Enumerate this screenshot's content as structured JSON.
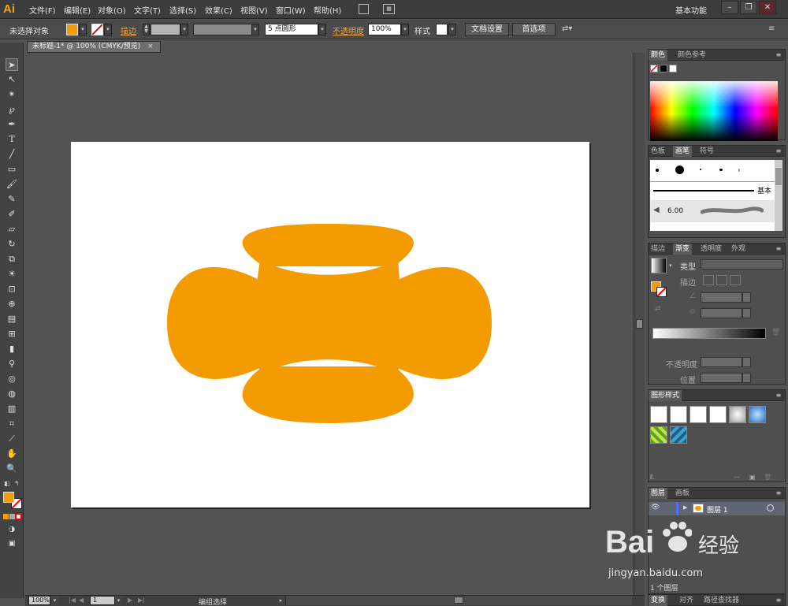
{
  "app": {
    "logo": "Ai",
    "workspace": "基本功能"
  },
  "menu": [
    "文件(F)",
    "编辑(E)",
    "对象(O)",
    "文字(T)",
    "选择(S)",
    "效果(C)",
    "视图(V)",
    "窗口(W)",
    "帮助(H)"
  ],
  "window_controls": {
    "minimize": "–",
    "restore": "❐",
    "close": "✕"
  },
  "control_bar": {
    "selection_label": "未选择对象",
    "stroke_label": "描边",
    "brush_value": "5 点圆形",
    "opacity_label": "不透明度",
    "opacity_value": "100%",
    "style_label": "样式",
    "doc_setup": "文档设置",
    "preferences": "首选项"
  },
  "document": {
    "tab_title": "未标题-1* @ 100% (CMYK/预览)",
    "close": "×"
  },
  "status": {
    "zoom": "100%",
    "page": "1",
    "mode": "编组选择"
  },
  "colors": {
    "fill": "#f39b00",
    "ui_accent": "#f0a23b"
  },
  "panels": {
    "color": {
      "tabs": [
        "颜色",
        "颜色参考"
      ]
    },
    "brushes": {
      "tabs": [
        "色板",
        "画笔",
        "符号"
      ],
      "basic_label": "基本",
      "size_value": "6.00"
    },
    "gradient": {
      "tabs": [
        "描边",
        "渐变",
        "透明度",
        "外观"
      ],
      "type_label": "类型",
      "stroke_label": "描边",
      "opacity_label": "不透明度",
      "position_label": "位置"
    },
    "graphic_styles": {
      "tabs": [
        "图形样式"
      ]
    },
    "layers": {
      "tabs": [
        "图层",
        "画板"
      ],
      "layer_name": "图层 1",
      "footer": "1 个图层"
    },
    "bottom": {
      "tabs": [
        "变换",
        "对齐",
        "路径查找器"
      ]
    }
  },
  "watermark": {
    "text": "Bai",
    "brand": "经验",
    "url": "jingyan.baidu.com"
  }
}
